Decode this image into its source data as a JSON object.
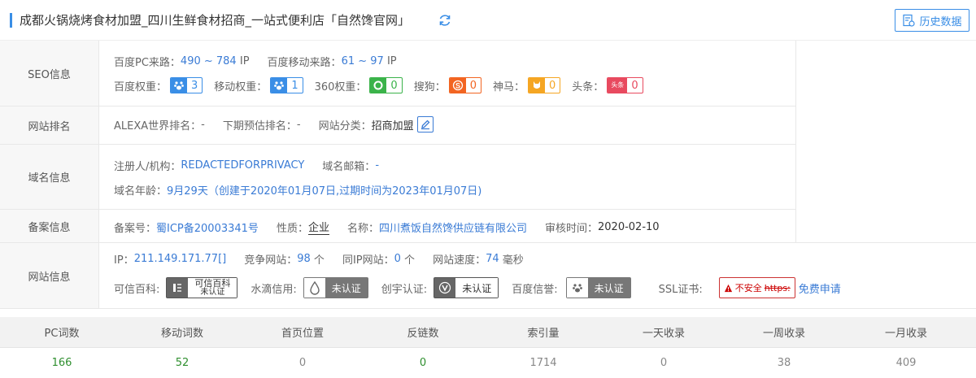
{
  "header": {
    "title": "成都火锅烧烤食材加盟_四川生鲜食材招商_一站式便利店「自然馋官网」",
    "history_button": "历史数据"
  },
  "seo": {
    "label": "SEO信息",
    "pc_traffic_label": "百度PC来路：",
    "pc_traffic_value": "490 ~ 784",
    "pc_traffic_unit": "IP",
    "mobile_traffic_label": "百度移动来路：",
    "mobile_traffic_value": "61 ~ 97",
    "mobile_traffic_unit": "IP",
    "weights": [
      {
        "label": "百度权重：",
        "value": "3",
        "color": "#3a8ee6",
        "icon": "paw-icon"
      },
      {
        "label": "移动权重：",
        "value": "1",
        "color": "#3a8ee6",
        "icon": "paw-icon"
      },
      {
        "label": "360权重：",
        "value": "0",
        "color": "#3bb34a",
        "icon": "360-icon"
      },
      {
        "label": "搜狗：",
        "value": "0",
        "color": "#f26522",
        "icon": "sogou-icon"
      },
      {
        "label": "神马：",
        "value": "0",
        "color": "#f5a623",
        "icon": "shenma-icon"
      },
      {
        "label": "头条：",
        "value": "0",
        "color": "#e84a5f",
        "icon": "toutiao-icon",
        "icon_text": "头条"
      }
    ]
  },
  "rank": {
    "label": "网站排名",
    "alexa_label": "ALEXA世界排名：",
    "alexa_value": "-",
    "next_label": "下期预估排名：",
    "next_value": "-",
    "category_label": "网站分类：",
    "category_value": "招商加盟"
  },
  "domain": {
    "label": "域名信息",
    "registrant_label": "注册人/机构：",
    "registrant_value": "REDACTEDFORPRIVACY",
    "email_label": "域名邮箱：",
    "email_value": "-",
    "age_label": "域名年龄：",
    "age_value": "9月29天（创建于2020年01月07日,过期时间为2023年01月07日)"
  },
  "icp": {
    "label": "备案信息",
    "number_label": "备案号：",
    "number_value": "蜀ICP备20003341号",
    "nature_label": "性质：",
    "nature_value": "企业",
    "name_label": "名称：",
    "name_value": "四川煮饭自然馋供应链有限公司",
    "audit_label": "审核时间：",
    "audit_value": "2020-02-10"
  },
  "site": {
    "label": "网站信息",
    "ip_label": "IP：",
    "ip_value": "211.149.171.77[]",
    "compete_label": "竞争网站：",
    "compete_value": "98",
    "compete_unit": "个",
    "sameip_label": "同IP网站：",
    "sameip_value": "0",
    "sameip_unit": "个",
    "speed_label": "网站速度：",
    "speed_value": "74",
    "speed_unit": "毫秒",
    "kexin_label": "可信百科:",
    "kexin_badge_line1": "可信百科",
    "kexin_badge_line2": "未认证",
    "shuidi_label": "水滴信用:",
    "shuidi_badge": "未认证",
    "chuangyu_label": "创宇认证:",
    "chuangyu_badge": "未认证",
    "baidu_credit_label": "百度信誉:",
    "baidu_credit_badge": "未认证",
    "ssl_label": "SSL证书:",
    "ssl_badge_text": "不安全",
    "ssl_badge_strike": "https:",
    "ssl_link": "免费申请"
  },
  "stats": {
    "headers": [
      "PC词数",
      "移动词数",
      "首页位置",
      "反链数",
      "索引量",
      "一天收录",
      "一周收录",
      "一月收录"
    ],
    "values": [
      "166",
      "52",
      "0",
      "0",
      "1714",
      "0",
      "38",
      "409"
    ]
  }
}
